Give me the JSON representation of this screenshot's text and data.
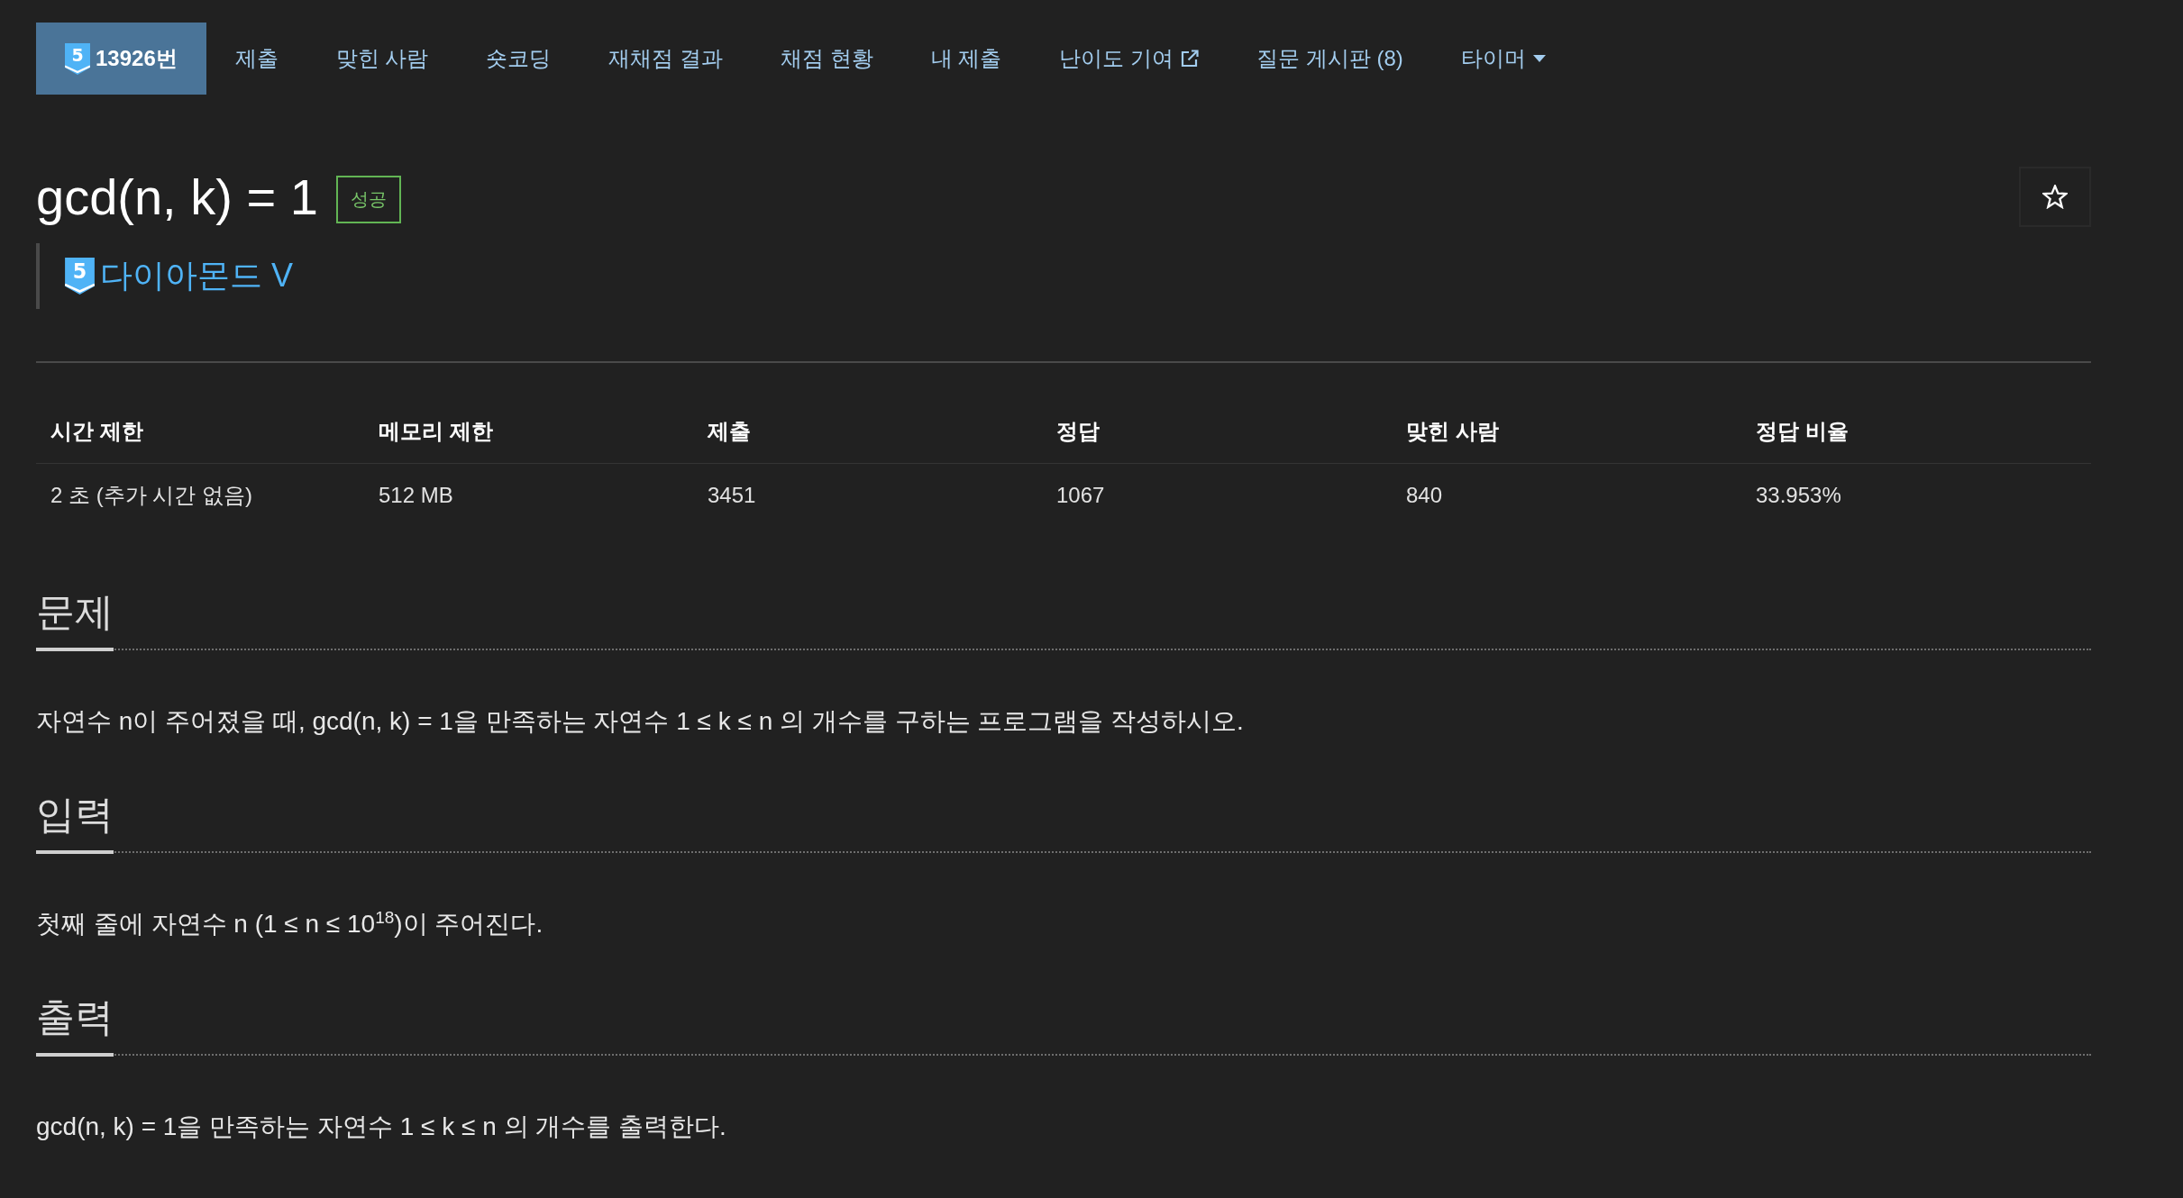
{
  "nav": {
    "tabs": [
      {
        "kind": "problem",
        "tier": "5",
        "label": "13926번",
        "selected": true
      },
      {
        "kind": "plain",
        "label": "제출",
        "selected": false
      },
      {
        "kind": "plain",
        "label": "맞힌 사람",
        "selected": false
      },
      {
        "kind": "plain",
        "label": "숏코딩",
        "selected": false
      },
      {
        "kind": "plain",
        "label": "재채점 결과",
        "selected": false
      },
      {
        "kind": "plain",
        "label": "채점 현황",
        "selected": false
      },
      {
        "kind": "plain",
        "label": "내 제출",
        "selected": false
      },
      {
        "kind": "external",
        "label": "난이도 기여",
        "selected": false
      },
      {
        "kind": "plain",
        "label": "질문 게시판 (8)",
        "selected": false
      },
      {
        "kind": "dropdown",
        "label": "타이머",
        "selected": false
      }
    ]
  },
  "problem": {
    "title": "gcd(n, k) = 1",
    "result_badge": "성공",
    "favorite": false,
    "tier": {
      "level": "5",
      "name": "다이아몬드 V"
    }
  },
  "info_table": {
    "columns": [
      "시간 제한",
      "메모리 제한",
      "제출",
      "정답",
      "맞힌 사람",
      "정답 비율"
    ],
    "rows": [
      [
        "2 초 (추가 시간 없음)",
        "512 MB",
        "3451",
        "1067",
        "840",
        "33.953%"
      ]
    ]
  },
  "sections": [
    {
      "heading": "문제",
      "body": "자연수 n이 주어졌을 때, gcd(n, k) = 1을 만족하는 자연수 1 ≤ k ≤ n 의 개수를 구하는 프로그램을 작성하시오."
    },
    {
      "heading": "입력",
      "body": "첫째 줄에 자연수 n (1 ≤ n ≤ 10$^{18}$)이 주어진다."
    },
    {
      "heading": "출력",
      "body": "gcd(n, k) = 1을 만족하는 자연수 1 ≤ k ≤ n 의 개수를 출력한다."
    }
  ]
}
